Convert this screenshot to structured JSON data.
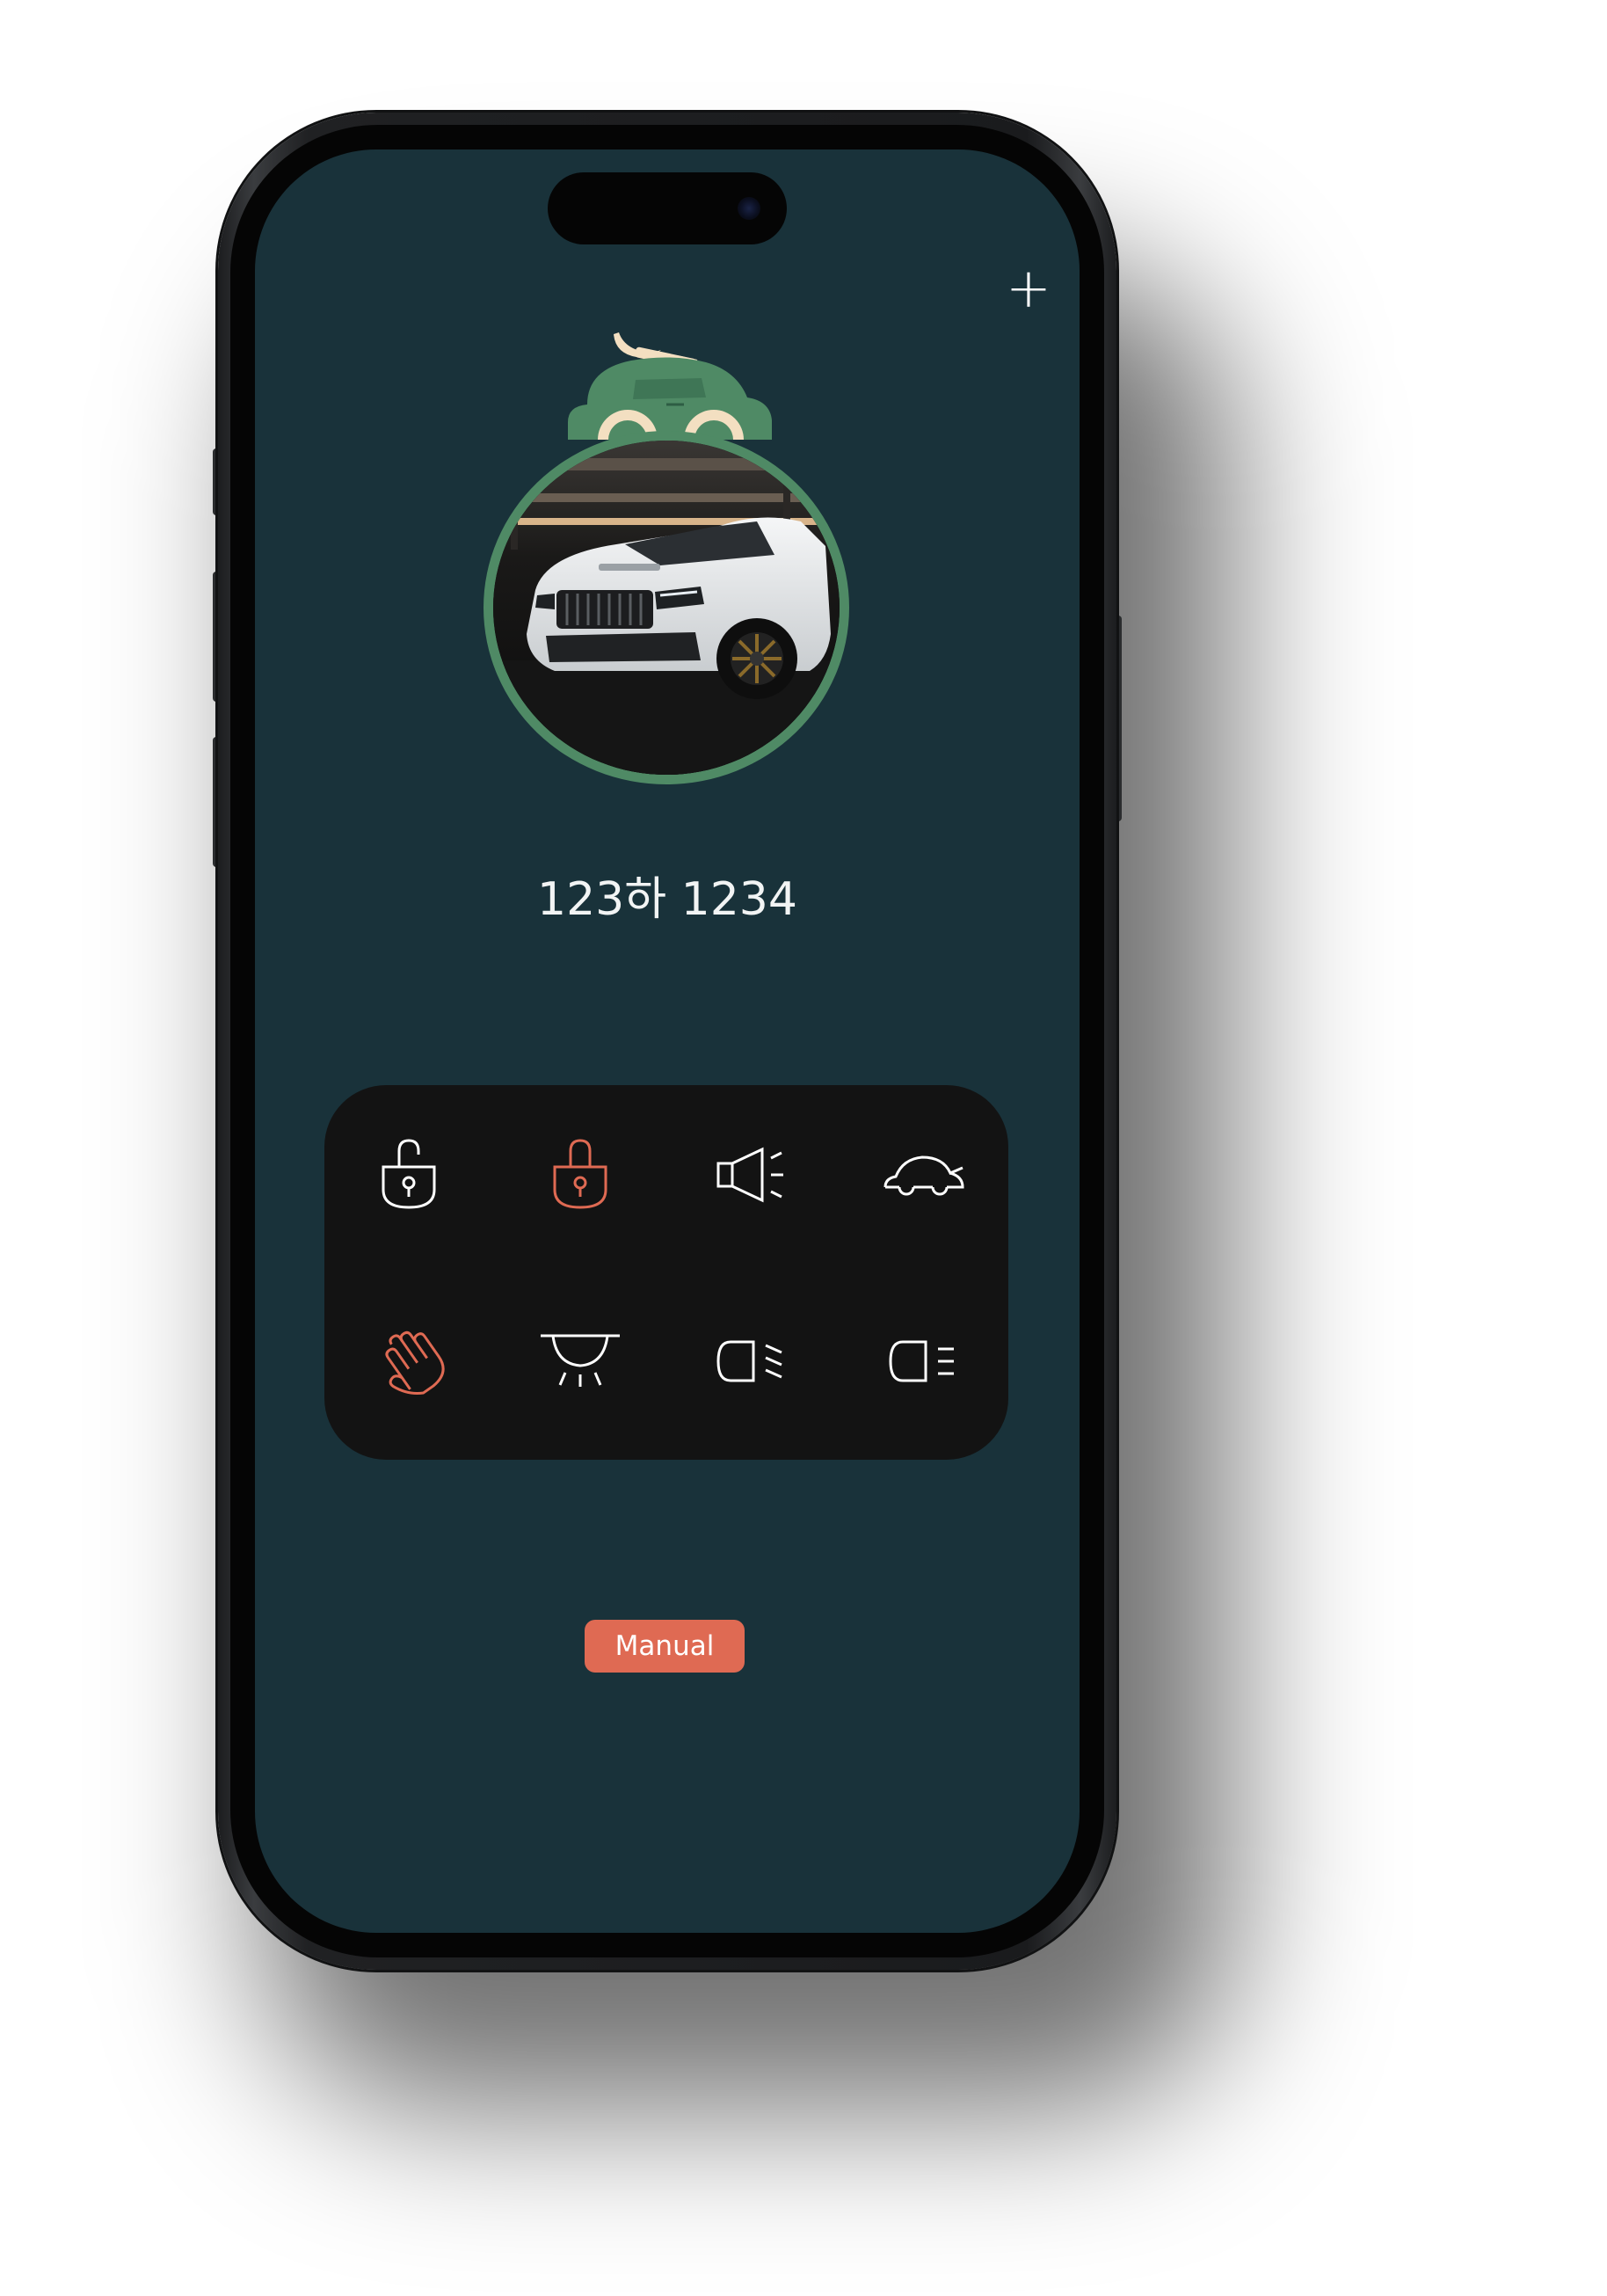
{
  "header": {
    "add_icon": "plus-icon",
    "add_label": "+"
  },
  "vehicle": {
    "plate_number": "123하 1234"
  },
  "controls": [
    {
      "name": "unlock",
      "icon": "unlock-icon",
      "color": "#ffffff"
    },
    {
      "name": "lock",
      "icon": "lock-icon",
      "color": "#df6a53"
    },
    {
      "name": "horn",
      "icon": "horn-icon",
      "color": "#ffffff"
    },
    {
      "name": "remote-start",
      "icon": "car-icon",
      "color": "#ffffff"
    },
    {
      "name": "hand-stop",
      "icon": "hand-icon",
      "color": "#df6a53"
    },
    {
      "name": "interior-light",
      "icon": "dome-light-icon",
      "color": "#ffffff"
    },
    {
      "name": "low-beam",
      "icon": "low-beam-icon",
      "color": "#ffffff"
    },
    {
      "name": "high-beam",
      "icon": "high-beam-icon",
      "color": "#ffffff"
    }
  ],
  "footer": {
    "manual_label": "Manual"
  },
  "colors": {
    "screen_background": "#19323a",
    "panel_background": "#131313",
    "accent": "#df6a53",
    "logo_green": "#4f8a65",
    "logo_cream": "#f3dfc1"
  }
}
